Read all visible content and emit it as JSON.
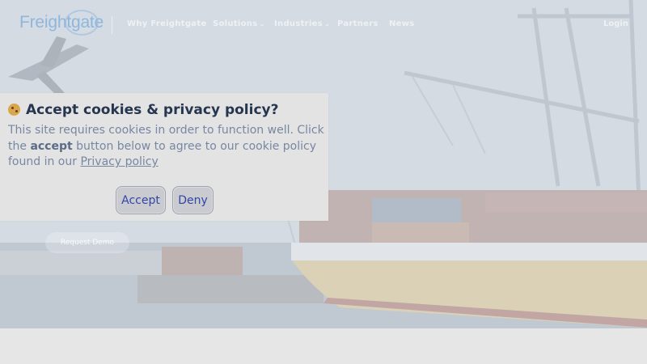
{
  "header": {
    "logo_text": "Freightgate",
    "nav": [
      {
        "label": "Why Freightgate",
        "has_dropdown": false
      },
      {
        "label": "Solutions",
        "has_dropdown": true
      },
      {
        "label": "Industries",
        "has_dropdown": true
      },
      {
        "label": "Partners",
        "has_dropdown": false
      },
      {
        "label": "News",
        "has_dropdown": false
      }
    ],
    "login_label": "Login",
    "chevron": "⌄"
  },
  "hero": {
    "request_demo_label": "Request Demo"
  },
  "cookie_dialog": {
    "title": "Accept cookies & privacy policy?",
    "icon": "cookie-icon",
    "body_pre": "This site requires cookies in order to function well. Click the ",
    "body_bold": "accept",
    "body_mid": " button below to agree to our cookie policy found in our ",
    "privacy_link": "Privacy policy",
    "accept_label": "Accept",
    "deny_label": "Deny"
  },
  "colors": {
    "title": "#26364f",
    "body_text": "#7787a2",
    "button_text": "#3346a4",
    "dialog_bg": "#e3e3e3"
  }
}
